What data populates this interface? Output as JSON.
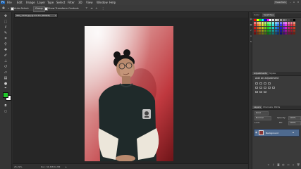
{
  "app": {
    "logo": "Ps"
  },
  "menu": [
    "File",
    "Edit",
    "Image",
    "Layer",
    "Type",
    "Select",
    "Filter",
    "3D",
    "View",
    "Window",
    "Help"
  ],
  "workspace": "Essentials",
  "window_controls": {
    "minimize": "–",
    "restore": "▫",
    "close": "×"
  },
  "options": {
    "auto_select": "Auto-Select:",
    "target": "Group",
    "show_transform": "Show Transform Controls"
  },
  "document": {
    "tab_title": "IMG_7239.jpg @ 25.3% (RGB/8)",
    "zoom": "25.29%",
    "doc_size": "Doc: 34.3M/34.3M"
  },
  "panels": {
    "color_tabs": [
      "Color",
      "Swatches"
    ],
    "adjust_tabs": [
      "Adjustments",
      "Styles"
    ],
    "adjust_title": "Add an adjustment",
    "layers_tabs": [
      "Layers",
      "Channels",
      "Paths"
    ],
    "layer_kind": "Kind",
    "blend_mode": "Normal",
    "opacity_label": "Opacity:",
    "opacity": "100%",
    "lock_label": "Lock:",
    "fill_label": "Fill:",
    "fill": "100%",
    "layer_name": "Background"
  },
  "colors": {
    "foreground": "#1fc72a",
    "background": "#ffffff",
    "layer_selected": "#4e6a8f"
  }
}
